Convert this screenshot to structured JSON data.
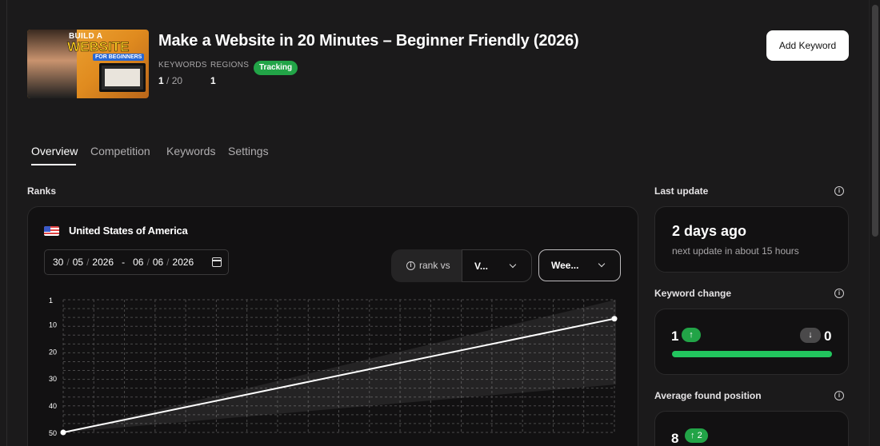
{
  "video": {
    "title": "Make a Website in 20 Minutes – Beginner Friendly (2026)",
    "thumbnail": {
      "line1": "BUILD A",
      "line2": "WEBSITE",
      "line3": "FOR BEGINNERS"
    },
    "keywords_label": "KEYWORDS",
    "keywords_used": "1",
    "keywords_total": " / 20",
    "regions_label": "REGIONS",
    "regions_count": "1",
    "status_badge": "Tracking"
  },
  "actions": {
    "add_keyword": "Add Keyword"
  },
  "tabs": [
    {
      "label": "Overview",
      "active": true
    },
    {
      "label": "Competition",
      "active": false
    },
    {
      "label": "Keywords",
      "active": false
    },
    {
      "label": "Settings",
      "active": false
    }
  ],
  "ranks": {
    "section_title": "Ranks",
    "country": "United States of America",
    "date_range": {
      "from": [
        "30",
        "05",
        "2026"
      ],
      "to": [
        "06",
        "06",
        "2026"
      ],
      "dash": "-",
      "sep": "/"
    },
    "rank_vs_label": "rank vs",
    "compare_select": "V...",
    "period_select": "Wee..."
  },
  "chart_data": {
    "type": "line",
    "y_ticks": [
      "1",
      "10",
      "20",
      "30",
      "40",
      "50"
    ],
    "y_reversed": true,
    "ylim": [
      1,
      50
    ],
    "grid": true,
    "series": [
      {
        "x": [
          0,
          1
        ],
        "values": [
          50,
          8
        ]
      }
    ],
    "line_color": "#ffffff"
  },
  "sidebar": {
    "last_update": {
      "label": "Last update",
      "value": "2 days ago",
      "sub": "next update in about 15 hours"
    },
    "keyword_change": {
      "label": "Keyword change",
      "up": "1",
      "down": "0",
      "up_share": 1.0
    },
    "average_found_position": {
      "label": "Average found position",
      "value": "8",
      "delta": "2"
    }
  },
  "colors": {
    "accent_green": "#22a447",
    "bar_green": "#22c55e",
    "background": "#1b1a1b",
    "card": "#121112"
  }
}
